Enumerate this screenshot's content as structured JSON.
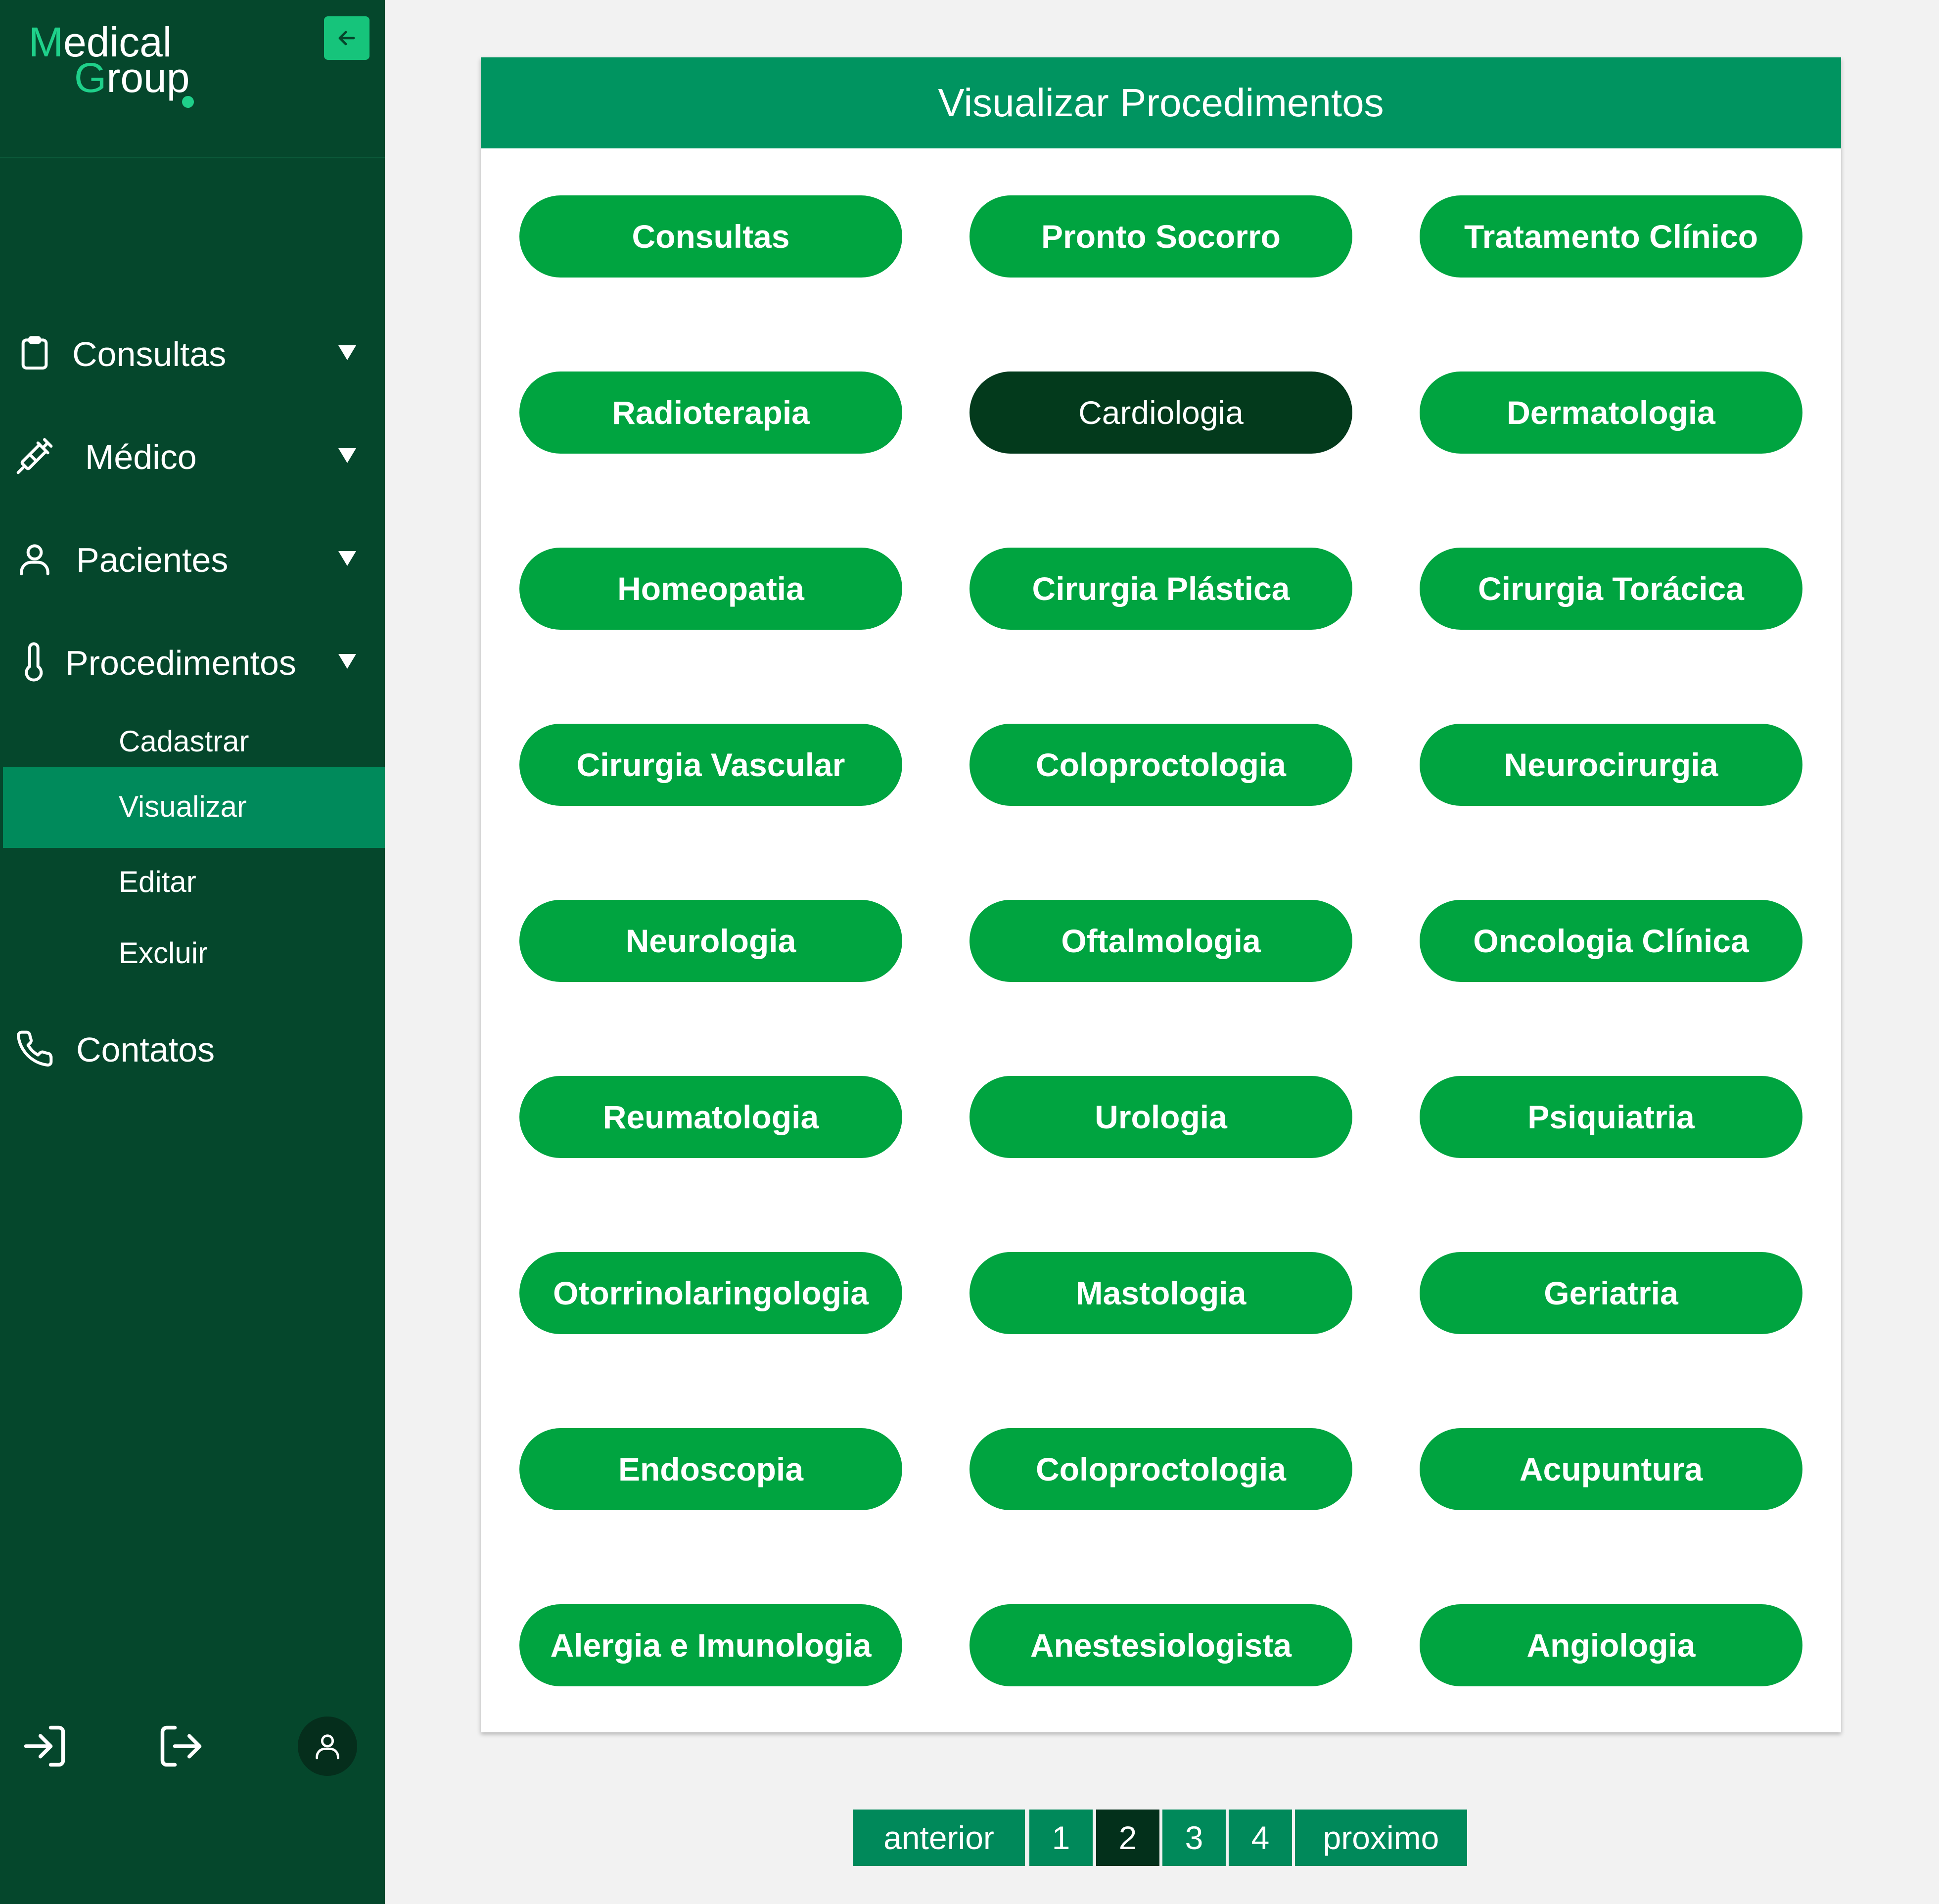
{
  "brand": {
    "line1_accent": "M",
    "line1_rest": "edical",
    "line2_accent": "G",
    "line2_rest": "roup"
  },
  "sidebar": {
    "menu": [
      {
        "label": "Consultas",
        "icon": "clipboard-icon"
      },
      {
        "label": "Médico",
        "icon": "syringe-icon"
      },
      {
        "label": "Pacientes",
        "icon": "user-icon"
      },
      {
        "label": "Procedimentos",
        "icon": "thermometer-icon"
      }
    ],
    "submenu": [
      {
        "label": "Cadastrar"
      },
      {
        "label": "Visualizar",
        "active": true
      },
      {
        "label": "Editar"
      },
      {
        "label": "Excluir"
      }
    ],
    "contacts": {
      "label": "Contatos",
      "icon": "phone-icon"
    },
    "bottom_icons": [
      "login-icon",
      "logout-icon",
      "user-avatar-icon"
    ]
  },
  "panel": {
    "title": "Visualizar Procedimentos",
    "procedures": [
      "Consultas",
      "Pronto Socorro",
      "Tratamento Clínico",
      "Radioterapia",
      "Cardiologia",
      "Dermatologia",
      "Homeopatia",
      "Cirurgia Plástica",
      "Cirurgia Torácica",
      "Cirurgia Vascular",
      "Coloproctologia",
      "Neurocirurgia",
      "Neurologia",
      "Oftalmologia",
      "Oncologia Clínica",
      "Reumatologia",
      "Urologia",
      "Psiquiatria",
      "Otorrinolaringologia",
      "Mastologia",
      "Geriatria",
      "Endoscopia",
      "Coloproctologia",
      "Acupuntura",
      "Alergia e Imunologia",
      "Anestesiologista",
      "Angiologia"
    ],
    "selected": "Cardiologia"
  },
  "pagination": {
    "prev": "anterior",
    "pages": [
      "1",
      "2",
      "3",
      "4"
    ],
    "current": "2",
    "next": "proximo"
  },
  "colors": {
    "sidebar": "#05472c",
    "accent": "#1fd08a",
    "header": "#009460",
    "button": "#00a440",
    "button_selected": "#033a1c",
    "page_button": "#00895a",
    "page_current": "#03301b"
  }
}
